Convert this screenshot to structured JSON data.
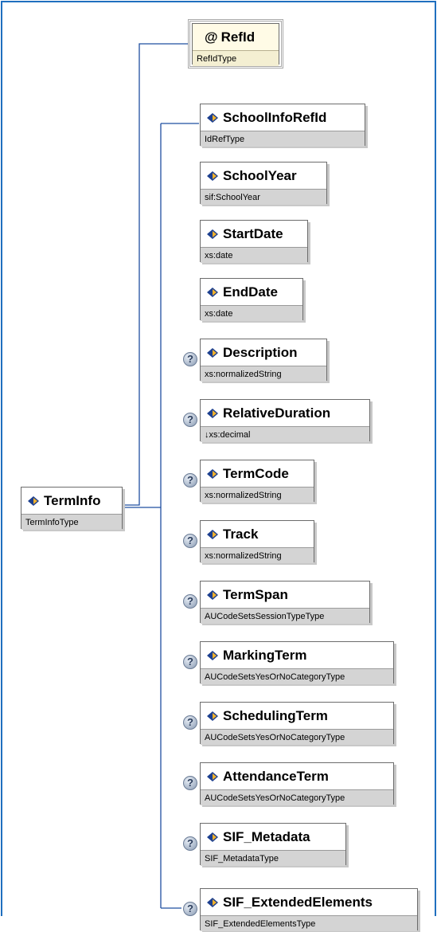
{
  "root": {
    "name": "TermInfo",
    "type": "TermInfoType"
  },
  "attribute": {
    "symbol": "@",
    "name": "RefId",
    "type": "RefIdType"
  },
  "elements": [
    {
      "name": "SchoolInfoRefId",
      "type": "IdRefType",
      "optional": false
    },
    {
      "name": "SchoolYear",
      "type": "sif:SchoolYear",
      "optional": false
    },
    {
      "name": "StartDate",
      "type": "xs:date",
      "optional": false
    },
    {
      "name": "EndDate",
      "type": "xs:date",
      "optional": false
    },
    {
      "name": "Description",
      "type": "xs:normalizedString",
      "optional": true
    },
    {
      "name": "RelativeDuration",
      "type": "↓xs:decimal",
      "optional": true
    },
    {
      "name": "TermCode",
      "type": "xs:normalizedString",
      "optional": true
    },
    {
      "name": "Track",
      "type": "xs:normalizedString",
      "optional": true
    },
    {
      "name": "TermSpan",
      "type": "AUCodeSetsSessionTypeType",
      "optional": true
    },
    {
      "name": "MarkingTerm",
      "type": "AUCodeSetsYesOrNoCategoryType",
      "optional": true
    },
    {
      "name": "SchedulingTerm",
      "type": "AUCodeSetsYesOrNoCategoryType",
      "optional": true
    },
    {
      "name": "AttendanceTerm",
      "type": "AUCodeSetsYesOrNoCategoryType",
      "optional": true
    },
    {
      "name": "SIF_Metadata",
      "type": "SIF_MetadataType",
      "optional": true
    },
    {
      "name": "SIF_ExtendedElements",
      "type": "SIF_ExtendedElementsType",
      "optional": true
    }
  ],
  "optional_marker": "?",
  "colors": {
    "frame": "#1f6fbf",
    "connector": "#1f4fa0",
    "type_band": "#d4d4d4"
  },
  "icons": {
    "element": "element-diamond-icon",
    "optional": "question-icon"
  }
}
